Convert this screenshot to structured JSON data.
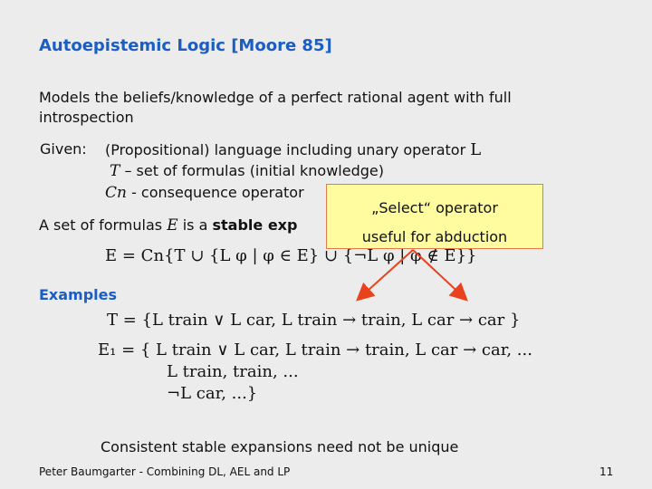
{
  "slide": {
    "title": "Autoepistemic Logic [Moore 85]",
    "intro_line1": "Models the beliefs/knowledge of a perfect rational agent with full",
    "intro_line2": "introspection",
    "given_label": "Given:",
    "given_line1_text": "(Propositional) language including unary operator",
    "given_line1_op": "L",
    "given_line2_sym": "T",
    "given_line2_text": "– set of formulas (initial knowledge)",
    "given_line3_sym": "Cn",
    "given_line3_text": "- consequence operator",
    "stable_prefix": "A set of formulas",
    "stable_sym": "E",
    "stable_mid": "is a",
    "stable_bold": "stable exp",
    "stable_suffix": ":",
    "stable_formula": "E = Cn{T ∪ {L φ | φ ∈ E} ∪ {¬L φ | φ ∉ E}}",
    "examples_label": "Examples",
    "example_T": "T = {L train ∨ L car,  L train → train,  L car → car  }",
    "example_E1_line1": "E₁ = {  L train ∨ L car,  L train → train,  L car → car,  ...",
    "example_E1_line2": "L train,  train, ...",
    "example_E1_line3": "¬L car, ...}",
    "conclusion": "Consistent stable expansions need not be unique",
    "footer_left": "Peter Baumgarter - Combining DL, AEL and LP",
    "page_number": "11"
  },
  "callout": {
    "line1": "„Select“ operator",
    "line2": "useful for abduction"
  },
  "colors": {
    "title": "#1a5ec4",
    "callout_bg": "#fffca0",
    "arrow": "#e8431c"
  }
}
